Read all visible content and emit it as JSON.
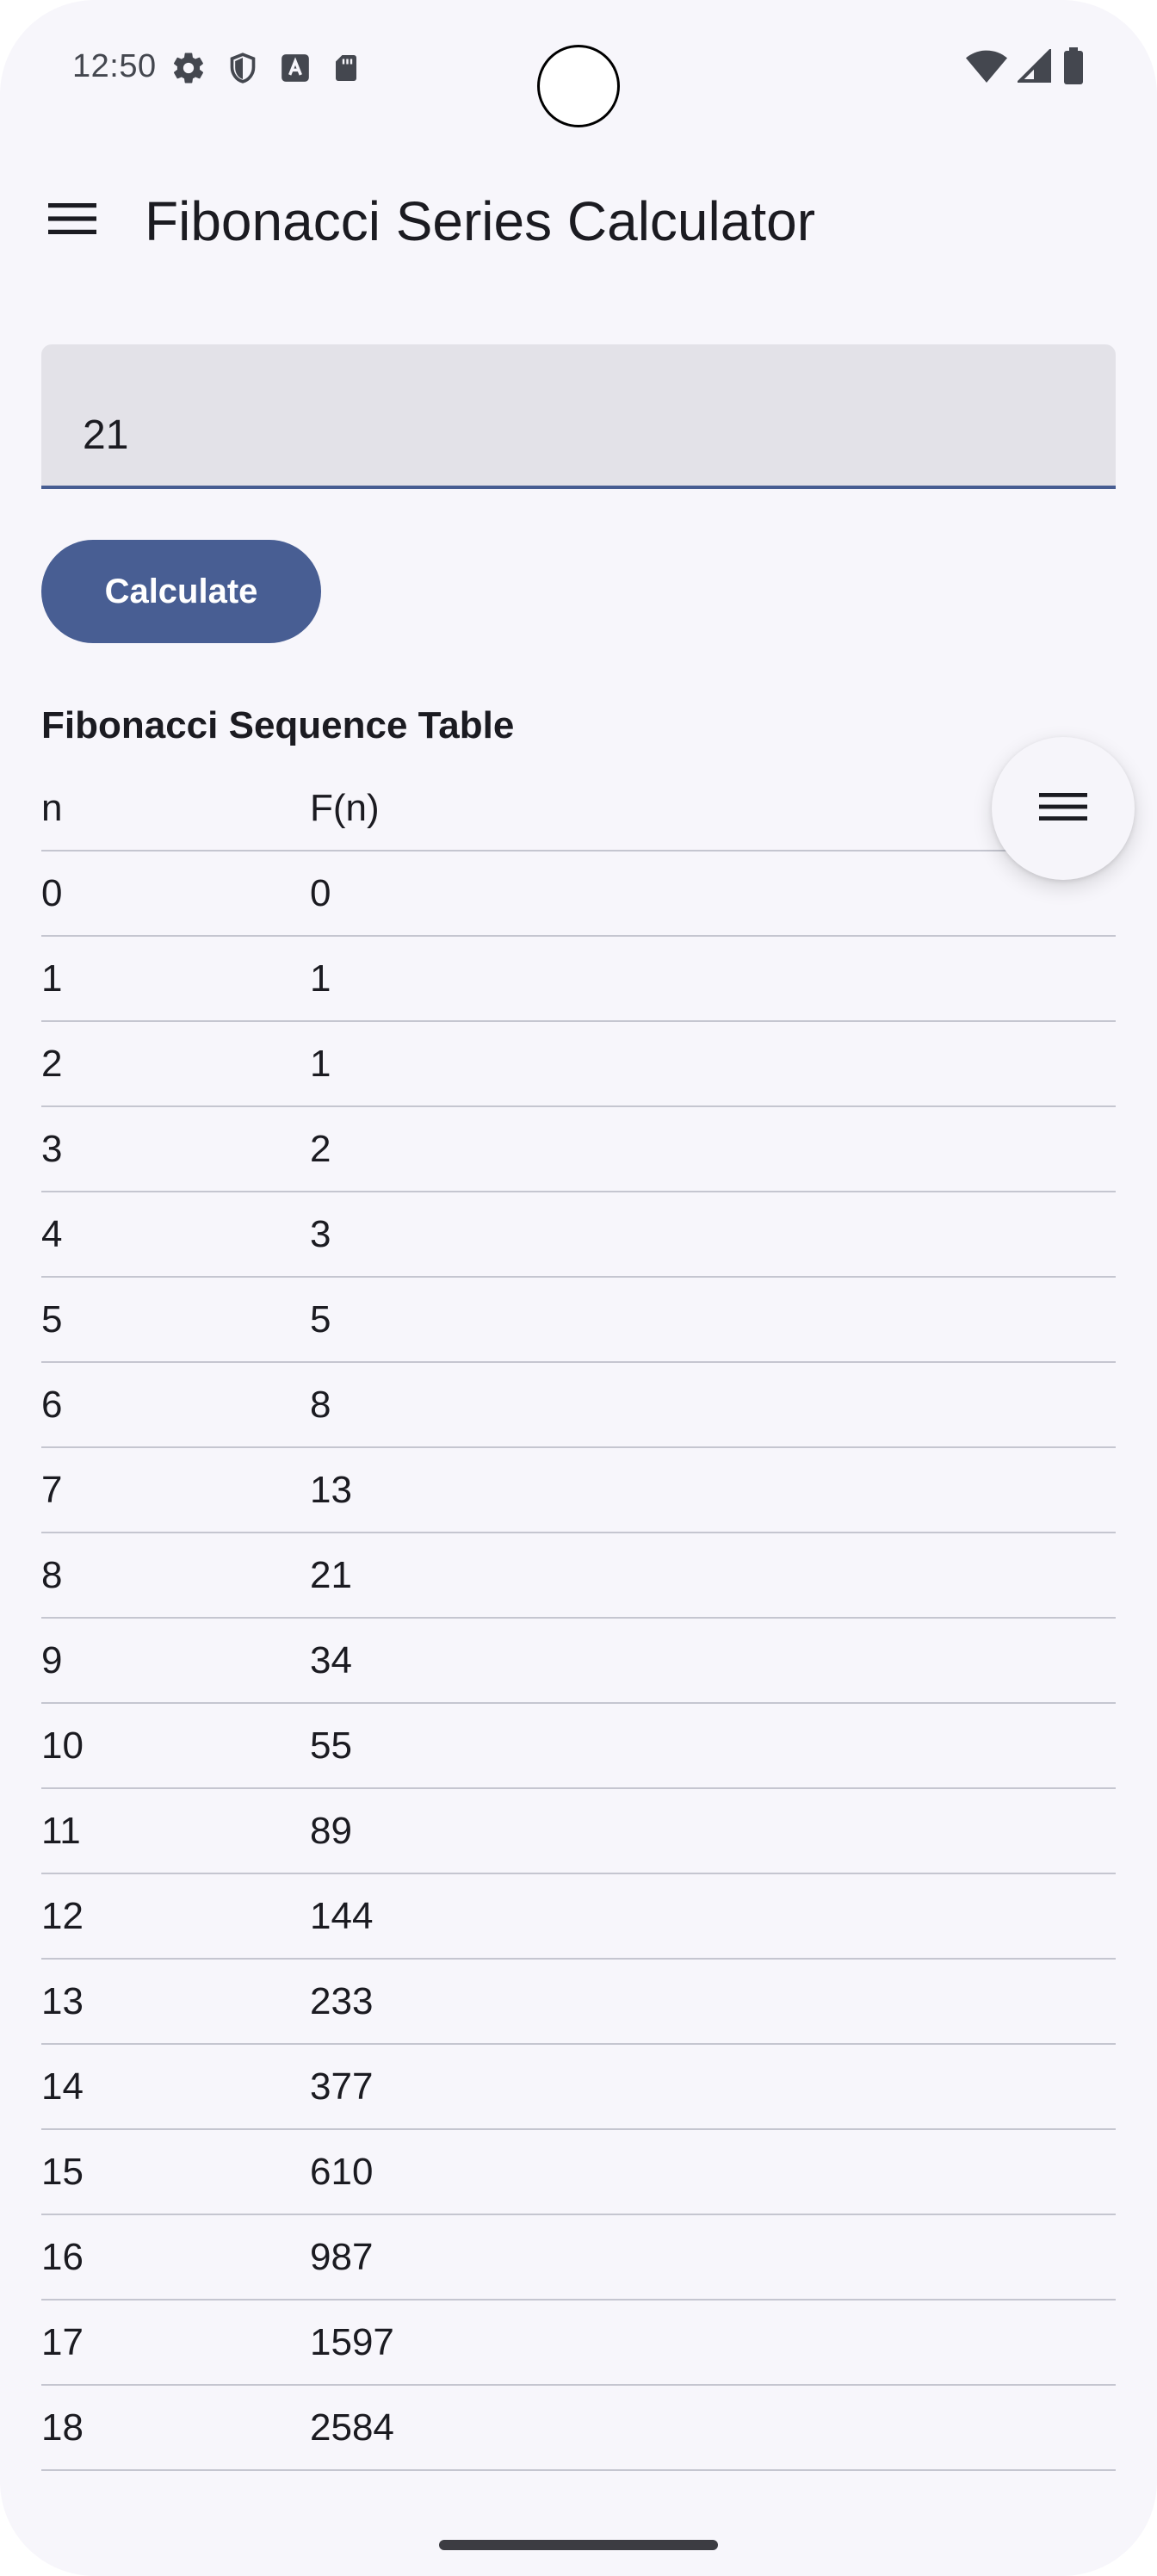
{
  "status_bar": {
    "time": "12:50",
    "left_icons": [
      "gear-icon",
      "shield-icon",
      "a-box-icon",
      "sd-card-icon"
    ],
    "right_icons": [
      "wifi-icon",
      "signal-icon",
      "battery-icon"
    ]
  },
  "app_bar": {
    "menu_icon": "hamburger-menu-icon",
    "title": "Fibonacci Series Calculator"
  },
  "input": {
    "value": "21"
  },
  "actions": {
    "calculate_label": "Calculate"
  },
  "table": {
    "title": "Fibonacci Sequence Table",
    "columns": [
      "n",
      "F(n)"
    ],
    "rows": [
      [
        "0",
        "0"
      ],
      [
        "1",
        "1"
      ],
      [
        "2",
        "1"
      ],
      [
        "3",
        "2"
      ],
      [
        "4",
        "3"
      ],
      [
        "5",
        "5"
      ],
      [
        "6",
        "8"
      ],
      [
        "7",
        "13"
      ],
      [
        "8",
        "21"
      ],
      [
        "9",
        "34"
      ],
      [
        "10",
        "55"
      ],
      [
        "11",
        "89"
      ],
      [
        "12",
        "144"
      ],
      [
        "13",
        "233"
      ],
      [
        "14",
        "377"
      ],
      [
        "15",
        "610"
      ],
      [
        "16",
        "987"
      ],
      [
        "17",
        "1597"
      ],
      [
        "18",
        "2584"
      ]
    ]
  },
  "fab": {
    "icon": "menu-lines-icon"
  },
  "colors": {
    "background": "#f7f6fb",
    "primary": "#485e93",
    "field_fill": "#e3e2e8",
    "divider": "#c5c6d0",
    "text": "#1b1b21"
  }
}
